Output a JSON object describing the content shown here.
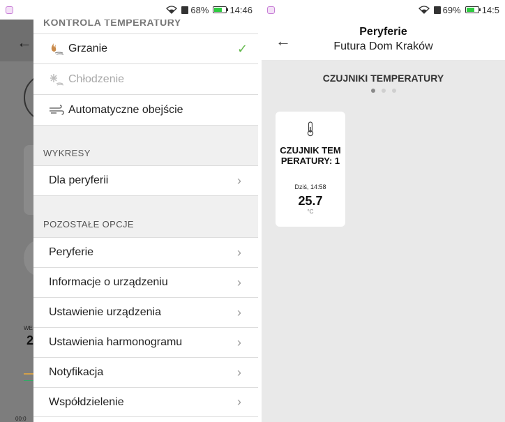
{
  "left": {
    "status": {
      "battery": "68%",
      "time": "14:46"
    },
    "drawer": {
      "section_temp_control": "KONTROLA TEMPERATURY",
      "items_temp": [
        {
          "label": "Grzanie",
          "selected": true,
          "icon": "flame-icon"
        },
        {
          "label": "Chłodzenie",
          "selected": false,
          "disabled": true,
          "icon": "snowflake-icon"
        },
        {
          "label": "Automatyczne obejście",
          "selected": false,
          "icon": "wind-icon"
        }
      ],
      "section_charts": "WYKRESY",
      "items_charts": [
        {
          "label": "Dla peryferii"
        }
      ],
      "section_other": "POZOSTAŁE OPCJE",
      "items_other": [
        {
          "label": "Peryferie"
        },
        {
          "label": "Informacje o urządzeniu"
        },
        {
          "label": "Ustawienie urządzenia"
        },
        {
          "label": "Ustawienia harmonogramu"
        },
        {
          "label": "Notyfikacja"
        },
        {
          "label": "Współdzielenie"
        }
      ]
    },
    "background": {
      "weekday_fragment": "WE",
      "day_fragment": "2",
      "time_fragment": "00:0"
    }
  },
  "right": {
    "status": {
      "battery": "69%",
      "time": "14:5"
    },
    "header": {
      "title": "Peryferie",
      "subtitle": "Futura Dom Kraków"
    },
    "section_title": "CZUJNIKI TEMPERATURY",
    "pager": {
      "pages": 3,
      "active": 0
    },
    "sensor": {
      "name": "CZUJNIK TEMPERATURY: 1",
      "timestamp": "Dziś, 14:58",
      "value": "25.7",
      "unit": "°C"
    }
  },
  "colors": {
    "accent_check": "#62b84b",
    "battery_fill": "#2ecc40",
    "scrim": "#7d7d7d",
    "section_bg": "#f0f0f0"
  }
}
